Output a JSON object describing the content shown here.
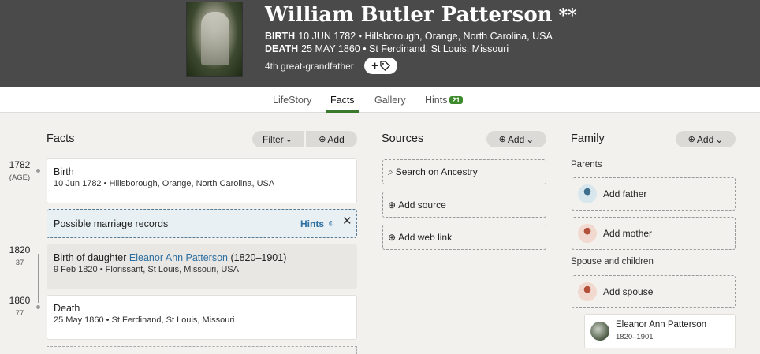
{
  "header": {
    "name": "William Butler Patterson",
    "stars": "**",
    "birth_label": "BIRTH",
    "birth_value": "10 JUN 1782 • Hillsborough, Orange, North Carolina, USA",
    "death_label": "DEATH",
    "death_value": "25 MAY 1860 • St Ferdinand, St Louis, Missouri",
    "relationship": "4th great-grandfather",
    "tag_button": "+"
  },
  "tabs": [
    {
      "label": "LifeStory"
    },
    {
      "label": "Facts"
    },
    {
      "label": "Gallery"
    },
    {
      "label": "Hints",
      "badge": "21"
    }
  ],
  "facts": {
    "title": "Facts",
    "filter_label": "Filter",
    "add_label": "Add",
    "items": [
      {
        "year": "1782",
        "age": "(AGE)",
        "title": "Birth",
        "sub": "10 Jun 1782 • Hillsborough, Orange, North Carolina, USA"
      },
      {
        "year": "1820",
        "age": "37",
        "title_prefix": "Birth of daughter ",
        "title_link": "Eleanor Ann Patterson",
        "title_suffix": " (1820–1901)",
        "sub": "9 Feb 1820 • Florissant, St Louis, Missouri, USA"
      },
      {
        "year": "1860",
        "age": "77",
        "title": "Death",
        "sub": "25 May 1860 • St Ferdinand, St Louis, Missouri"
      }
    ],
    "hint": {
      "text": "Possible marriage records",
      "link": "Hints",
      "close": "✕"
    }
  },
  "sources": {
    "title": "Sources",
    "add_label": "Add",
    "search": "Search on Ancestry",
    "add_source": "Add source",
    "add_web_link": "Add web link"
  },
  "family": {
    "title": "Family",
    "add_label": "Add",
    "parents_label": "Parents",
    "add_father": "Add father",
    "add_mother": "Add mother",
    "spouse_label": "Spouse and children",
    "add_spouse": "Add spouse",
    "child_name": "Eleanor Ann Patterson",
    "child_dates": "1820–1901"
  }
}
